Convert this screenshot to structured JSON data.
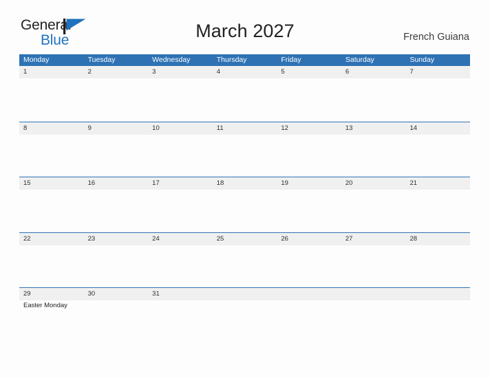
{
  "brand": {
    "name_part1": "General",
    "name_part2": "Blue",
    "flag_icon": "flag-triangle-icon",
    "accent_color": "#1f72bd"
  },
  "header": {
    "title": "March 2027",
    "region": "French Guiana"
  },
  "theme": {
    "header_blue": "#2e72b4",
    "daynum_band": "#f0f0f0",
    "page_background": "#fdfdfd",
    "text_color": "#222222"
  },
  "calendar": {
    "month": "March",
    "year": "2027",
    "weekday_headers": [
      "Monday",
      "Tuesday",
      "Wednesday",
      "Thursday",
      "Friday",
      "Saturday",
      "Sunday"
    ],
    "weeks": [
      {
        "days": [
          {
            "num": "1",
            "events": []
          },
          {
            "num": "2",
            "events": []
          },
          {
            "num": "3",
            "events": []
          },
          {
            "num": "4",
            "events": []
          },
          {
            "num": "5",
            "events": []
          },
          {
            "num": "6",
            "events": []
          },
          {
            "num": "7",
            "events": []
          }
        ]
      },
      {
        "days": [
          {
            "num": "8",
            "events": []
          },
          {
            "num": "9",
            "events": []
          },
          {
            "num": "10",
            "events": []
          },
          {
            "num": "11",
            "events": []
          },
          {
            "num": "12",
            "events": []
          },
          {
            "num": "13",
            "events": []
          },
          {
            "num": "14",
            "events": []
          }
        ]
      },
      {
        "days": [
          {
            "num": "15",
            "events": []
          },
          {
            "num": "16",
            "events": []
          },
          {
            "num": "17",
            "events": []
          },
          {
            "num": "18",
            "events": []
          },
          {
            "num": "19",
            "events": []
          },
          {
            "num": "20",
            "events": []
          },
          {
            "num": "21",
            "events": []
          }
        ]
      },
      {
        "days": [
          {
            "num": "22",
            "events": []
          },
          {
            "num": "23",
            "events": []
          },
          {
            "num": "24",
            "events": []
          },
          {
            "num": "25",
            "events": []
          },
          {
            "num": "26",
            "events": []
          },
          {
            "num": "27",
            "events": []
          },
          {
            "num": "28",
            "events": []
          }
        ]
      },
      {
        "days": [
          {
            "num": "29",
            "events": [
              "Easter Monday"
            ]
          },
          {
            "num": "30",
            "events": []
          },
          {
            "num": "31",
            "events": []
          },
          {
            "num": "",
            "events": []
          },
          {
            "num": "",
            "events": []
          },
          {
            "num": "",
            "events": []
          },
          {
            "num": "",
            "events": []
          }
        ]
      }
    ]
  }
}
